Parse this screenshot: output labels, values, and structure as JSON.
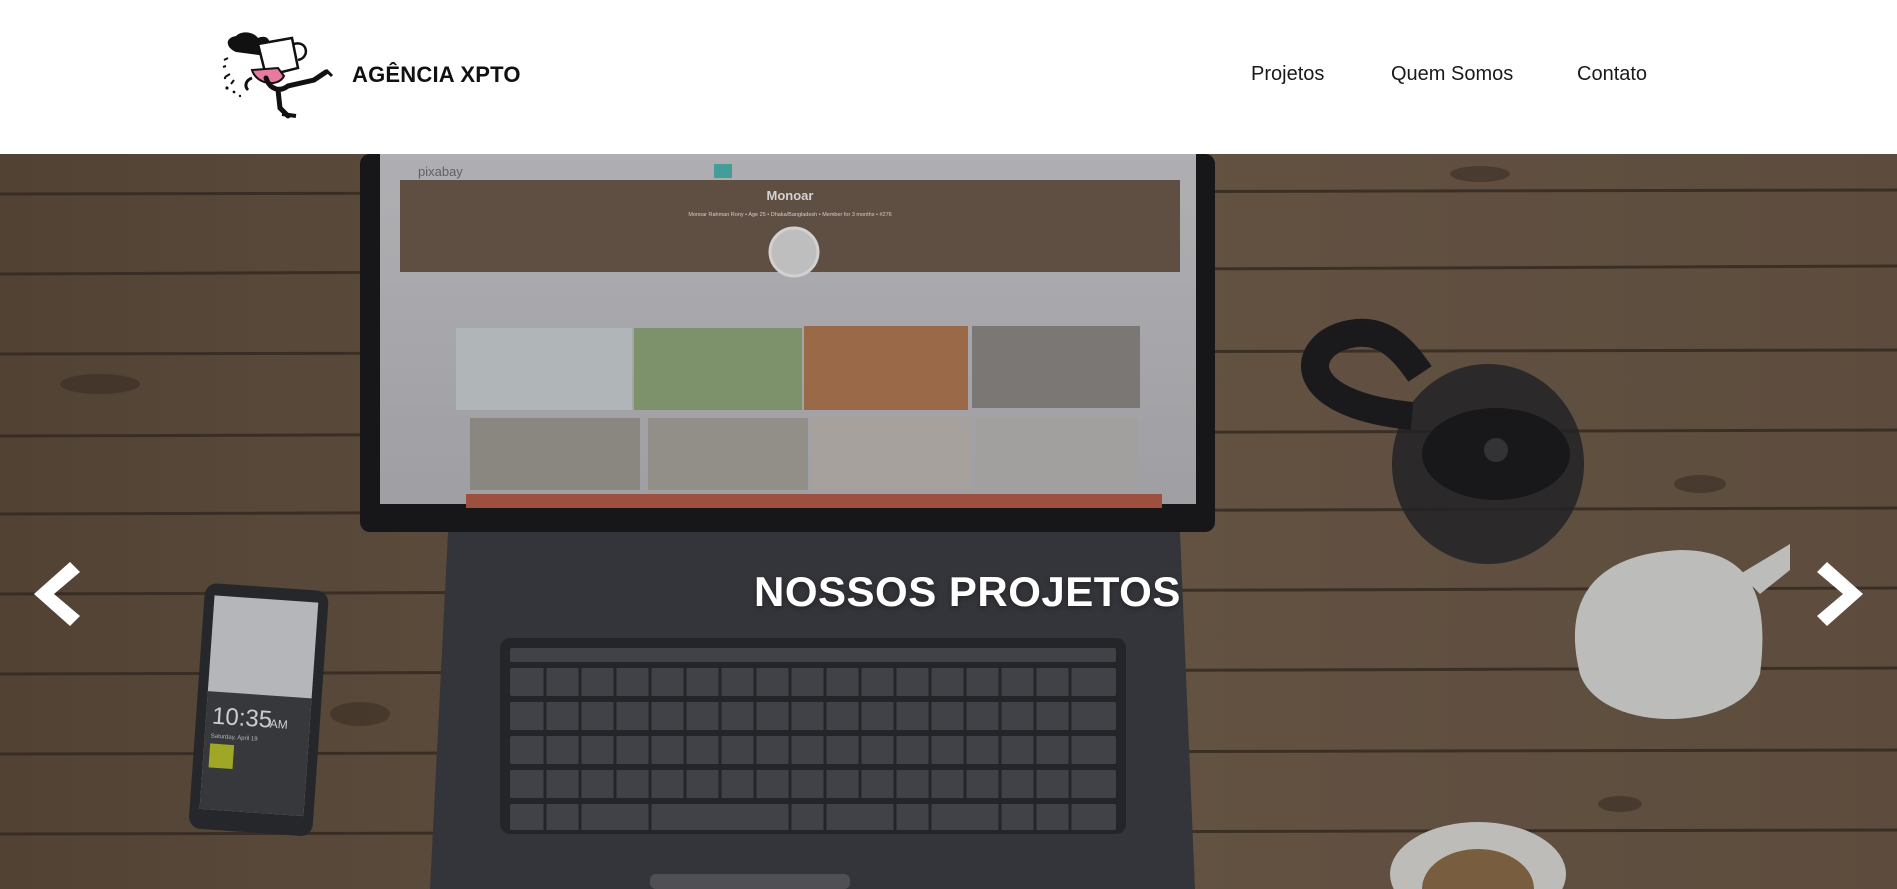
{
  "header": {
    "brand": "AGÊNCIA XPTO",
    "logo_icon": "running-coffee-cup-mascot",
    "nav": [
      {
        "label": "Projetos"
      },
      {
        "label": "Quem Somos"
      },
      {
        "label": "Contato"
      }
    ]
  },
  "hero": {
    "title": "NOSSOS PROJETOS",
    "prev_icon": "chevron-left-icon",
    "next_icon": "chevron-right-icon",
    "laptop_screen": {
      "site": "pixabay",
      "profile_name": "Monoar",
      "profile_meta": "Monoar Rahman Rony  •  Age 25  •  Dhaka/Bangladesh  •  Member for 3 months  •  #276"
    },
    "phone": {
      "time": "10:35",
      "ampm": "AM",
      "date": "Saturday, April 19"
    }
  },
  "colors": {
    "wood_dark": "#5b4a3a",
    "wood_light": "#7a6654",
    "laptop_body": "#3a3b40",
    "title_text": "#ffffff"
  }
}
